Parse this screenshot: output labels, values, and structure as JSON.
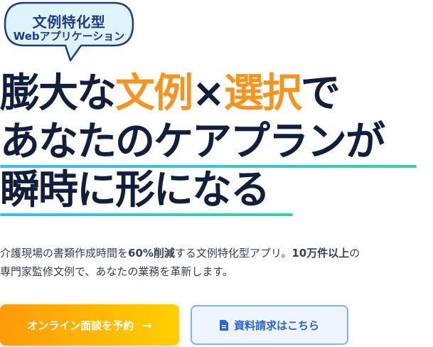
{
  "badge": {
    "line1": "文例特化型",
    "line2": "Webアプリケーション"
  },
  "headline": {
    "line1_part1": "膨大な",
    "line1_part2": "文例",
    "line1_part3": "×",
    "line1_part4": "選択",
    "line1_part5": "で",
    "line2": "あなたのケアプランが",
    "line3": "瞬時に形になる"
  },
  "description": {
    "part1": "介護現場の書類作成時間を",
    "bold1": "60%削減",
    "part2": "する文例特化型アプリ。",
    "bold2": "10万件以上",
    "part3": "の専門家監修文例で、あなたの業務を革新します。"
  },
  "cta": {
    "primary_label": "オンライン面談を予約",
    "primary_arrow": "→",
    "secondary_label": "資料請求はこちら"
  },
  "icons": {
    "primary_arrow_icon": "arrow-right-icon",
    "secondary_icon": "document-icon"
  },
  "colors": {
    "headline": "#0f1f3d",
    "accent_orange": "#f5951f",
    "badge_border": "#1e3a8a",
    "badge_fill": "#dff3ff",
    "primary_gradient_start": "#ff9a0a",
    "primary_gradient_end": "#ffd000",
    "secondary_text": "#2563eb",
    "secondary_border": "#7db2ff",
    "underline_start": "#38bdf8",
    "underline_end": "#34d399"
  }
}
